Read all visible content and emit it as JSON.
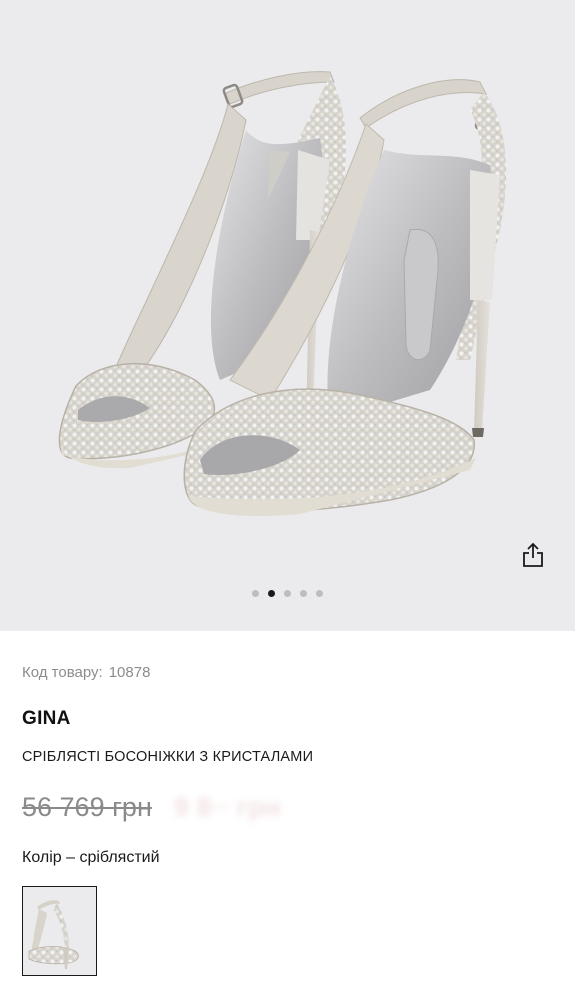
{
  "gallery": {
    "image_alt": "Silver sandals with crystals",
    "slide_count": 5,
    "active_slide": 2,
    "share_icon": "share-icon"
  },
  "product": {
    "sku_label": "Код товару:",
    "sku_value": "10878",
    "brand": "GINA",
    "name": "СРІБЛЯСТІ БОСОНІЖКИ З КРИСТАЛАМИ",
    "old_price": "56 769 грн",
    "new_price": "9 8·· грн",
    "color_label": "Колір – сріблястий"
  },
  "colors": {
    "gallery_bg": "#ebebed",
    "text": "#1a1a1a",
    "muted": "#8c8c8c",
    "sale_price": "#f3e3e3"
  }
}
